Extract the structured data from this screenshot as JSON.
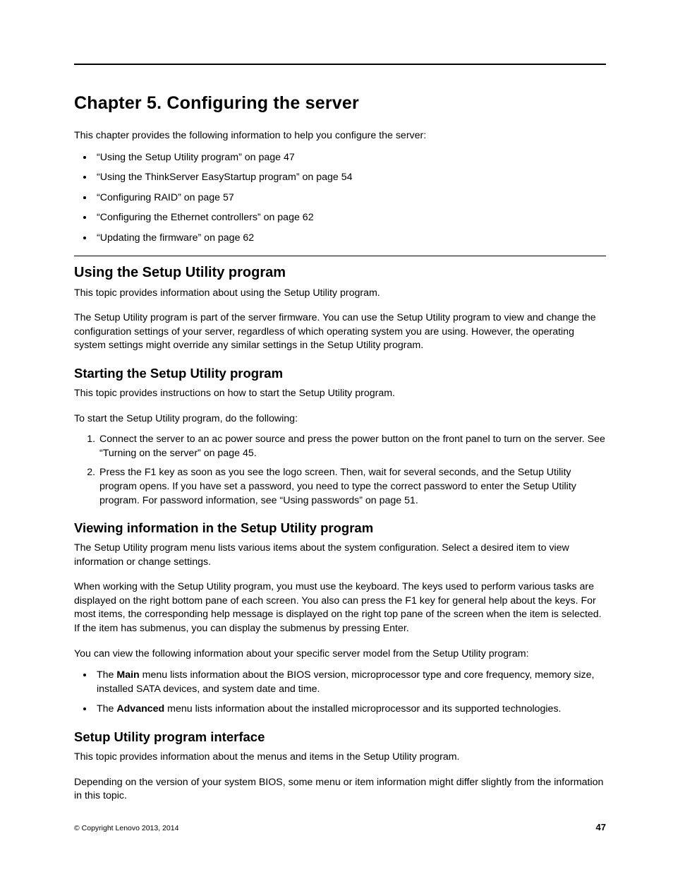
{
  "chapter": {
    "title": "Chapter 5.   Configuring the server",
    "intro": "This chapter provides the following information to help you configure the server:",
    "toc": [
      "“Using the Setup Utility program” on page 47",
      "“Using the ThinkServer EasyStartup program” on page 54",
      "“Configuring RAID” on page 57",
      "“Configuring the Ethernet controllers” on page 62",
      "“Updating the firmware” on page 62"
    ]
  },
  "sec_using": {
    "heading": "Using the Setup Utility program",
    "p1": "This topic provides information about using the Setup Utility program.",
    "p2": "The Setup Utility program is part of the server firmware. You can use the Setup Utility program to view and change the configuration settings of your server, regardless of which operating system you are using. However, the operating system settings might override any similar settings in the Setup Utility program."
  },
  "sec_starting": {
    "heading": "Starting the Setup Utility program",
    "p1": "This topic provides instructions on how to start the Setup Utility program.",
    "p2": "To start the Setup Utility program, do the following:",
    "steps": [
      "Connect the server to an ac power source and press the power button on the front panel to turn on the server. See “Turning on the server” on page 45.",
      "Press the F1 key as soon as you see the logo screen. Then, wait for several seconds, and the Setup Utility program opens. If you have set a password, you need to type the correct password to enter the Setup Utility program. For password information, see “Using passwords” on page 51."
    ]
  },
  "sec_viewing": {
    "heading": "Viewing information in the Setup Utility program",
    "p1": "The Setup Utility program menu lists various items about the system configuration. Select a desired item to view information or change settings.",
    "p2": "When working with the Setup Utility program, you must use the keyboard. The keys used to perform various tasks are displayed on the right bottom pane of each screen. You also can press the F1 key for general help about the keys. For most items, the corresponding help message is displayed on the right top pane of the screen when the item is selected. If the item has submenus, you can display the submenus by pressing Enter.",
    "p3": "You can view the following information about your specific server model from the Setup Utility program:",
    "bullets": [
      {
        "pre": "The ",
        "bold": "Main",
        "post": " menu lists information about the BIOS version, microprocessor type and core frequency, memory size, installed SATA devices, and system date and time."
      },
      {
        "pre": "The ",
        "bold": "Advanced",
        "post": " menu lists information about the installed microprocessor and its supported technologies."
      }
    ]
  },
  "sec_interface": {
    "heading": "Setup Utility program interface",
    "p1": "This topic provides information about the menus and items in the Setup Utility program.",
    "p2": "Depending on the version of your system BIOS, some menu or item information might differ slightly from the information in this topic."
  },
  "footer": {
    "copyright": "© Copyright Lenovo 2013, 2014",
    "pagenum": "47"
  }
}
